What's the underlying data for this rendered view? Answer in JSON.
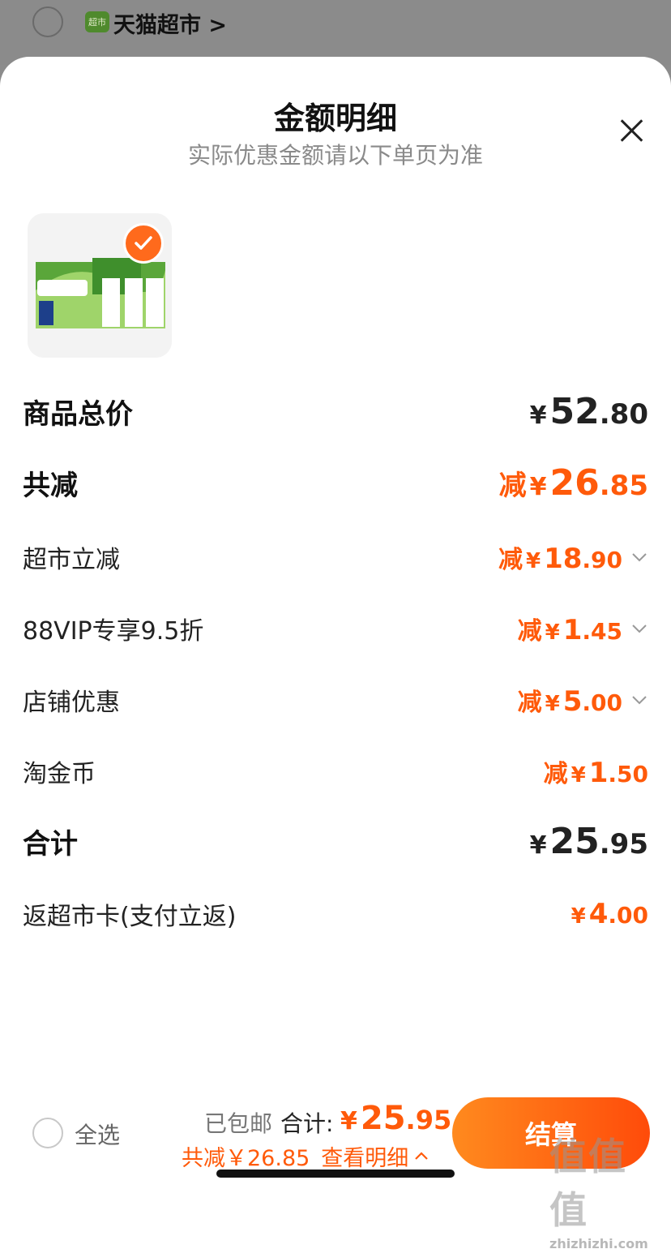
{
  "store": {
    "badge": "超市",
    "name": "天猫超市 >"
  },
  "sheet": {
    "title": "金额明细",
    "subtitle": "实际优惠金额请以下单页为准"
  },
  "colors": {
    "accent": "#ff5a0a",
    "check": "#ff6a1c"
  },
  "rows": {
    "total_price": {
      "label": "商品总价",
      "yen": "¥",
      "int": "52",
      "dec": ".80"
    },
    "total_reduce": {
      "label": "共减",
      "pre": "减",
      "yen": "¥",
      "int": "26",
      "dec": ".85"
    },
    "supermarket": {
      "label": "超市立减",
      "pre": "减",
      "yen": "¥",
      "int": "18",
      "dec": ".90"
    },
    "vip": {
      "label": "88VIP专享9.5折",
      "pre": "减",
      "yen": "¥",
      "int": "1",
      "dec": ".45"
    },
    "shop": {
      "label": "店铺优惠",
      "pre": "减",
      "yen": "¥",
      "int": "5",
      "dec": ".00"
    },
    "coins": {
      "label": "淘金币",
      "pre": "减",
      "yen": "¥",
      "int": "1",
      "dec": ".50"
    },
    "sum": {
      "label": "合计",
      "yen": "¥",
      "int": "25",
      "dec": ".95"
    },
    "cashback": {
      "label": "返超市卡(支付立返)",
      "yen": "¥",
      "int": "4",
      "dec": ".00"
    }
  },
  "bottom": {
    "select_all": "全选",
    "free_shipping": "已包邮",
    "total_label": "合计:",
    "total_yen": "¥",
    "total_int": "25",
    "total_dec": ".95",
    "saved": "共减￥26.85",
    "details_link": "查看明细",
    "checkout": "结算"
  },
  "watermark": {
    "text": "值值值",
    "domain": "zhizhizhi.com"
  },
  "icons": [
    "radio-icon",
    "close-icon",
    "check-icon",
    "chevron-down-icon",
    "chevron-up-icon"
  ]
}
